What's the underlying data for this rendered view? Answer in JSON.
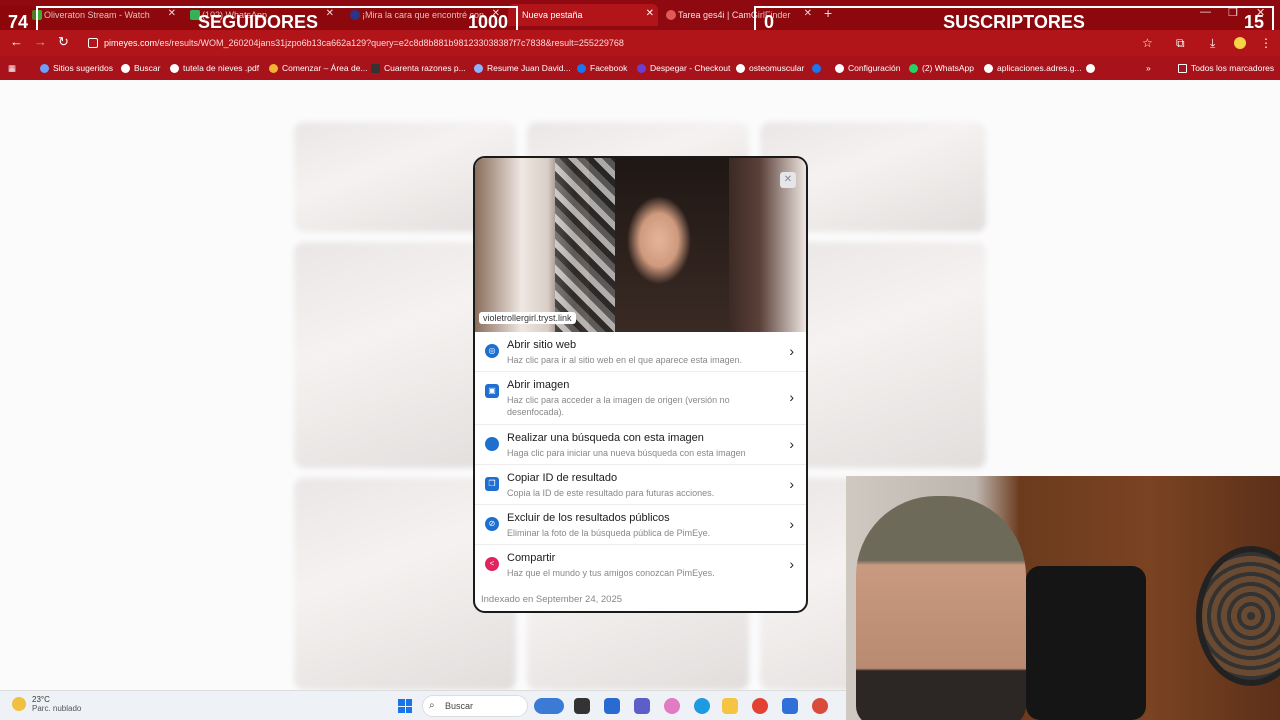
{
  "browser": {
    "tabs": [
      {
        "label": "Oliveraton Stream - Watch",
        "active": false,
        "color": "#2ecc40"
      },
      {
        "label": "(102) WhatsApp",
        "active": false,
        "color": "#25d366"
      },
      {
        "label": "¡Mira la cara que encontré con",
        "active": false,
        "color": "#1a3fa0"
      },
      {
        "label": "Nueva pestaña",
        "active": true,
        "color": "#ffffff"
      },
      {
        "label": "Tarea ges4i | CamGirlFinder",
        "active": false,
        "color": "#e05a5a"
      }
    ],
    "url": {
      "host": "pimeyes.com",
      "path": "/es/results/WOM_260204jans31jzpo6b13ca662a129?query=e2c8d8b881b981233038387f7c7838&result=255229768"
    },
    "bookmarks": [
      "Sitios sugeridos",
      "Buscar",
      "tutela de nieves .pdf",
      "Comenzar – Área de...",
      "Cuarenta razones p...",
      "Resume Juan David...",
      "Facebook",
      "Despegar - Checkout",
      "osteomuscular",
      "Configuración",
      "(2) WhatsApp",
      "aplicaciones.adres.g..."
    ],
    "all_bookmarks": "Todos los marcadores"
  },
  "overlay": {
    "left_counter": "74",
    "followers_label": "SEGUIDORES",
    "followers_goal": "1000",
    "subs_current": "0",
    "subs_label": "SUSCRIPTORES",
    "subs_goal": "15"
  },
  "modal": {
    "source_link": "violetrollergirl.tryst.link",
    "close_icon": "close-icon",
    "items": [
      {
        "title": "Abrir sitio web",
        "desc": "Haz clic para ir al sitio web en el que aparece esta imagen.",
        "icon": "globe-icon",
        "color": "#1f6fd0"
      },
      {
        "title": "Abrir imagen",
        "desc": "Haz clic para acceder a la imagen de origen (versión no desenfocada).",
        "icon": "image-icon",
        "color": "#1f6fd0"
      },
      {
        "title": "Realizar una búsqueda con esta imagen",
        "desc": "Haga clic para iniciar una nueva búsqueda con esta imagen",
        "icon": "search-dot-icon",
        "color": "#1f6fd0"
      },
      {
        "title": "Copiar ID de resultado",
        "desc": "Copia la ID de este resultado para futuras acciones.",
        "icon": "copy-icon",
        "color": "#1f6fd0"
      },
      {
        "title": "Excluir de los resultados públicos",
        "desc": "Eliminar la foto de la búsqueda pública de PimEye.",
        "icon": "hide-icon",
        "color": "#1f6fd0"
      },
      {
        "title": "Compartir",
        "desc": "Haz que el mundo y tus amigos conozcan PimEyes.",
        "icon": "share-icon",
        "color": "#e0245e"
      }
    ],
    "indexed": "Indexado en September 24, 2025"
  },
  "taskbar": {
    "temperature": "23°C",
    "condition": "Parc. nublado",
    "search_placeholder": "Buscar"
  }
}
